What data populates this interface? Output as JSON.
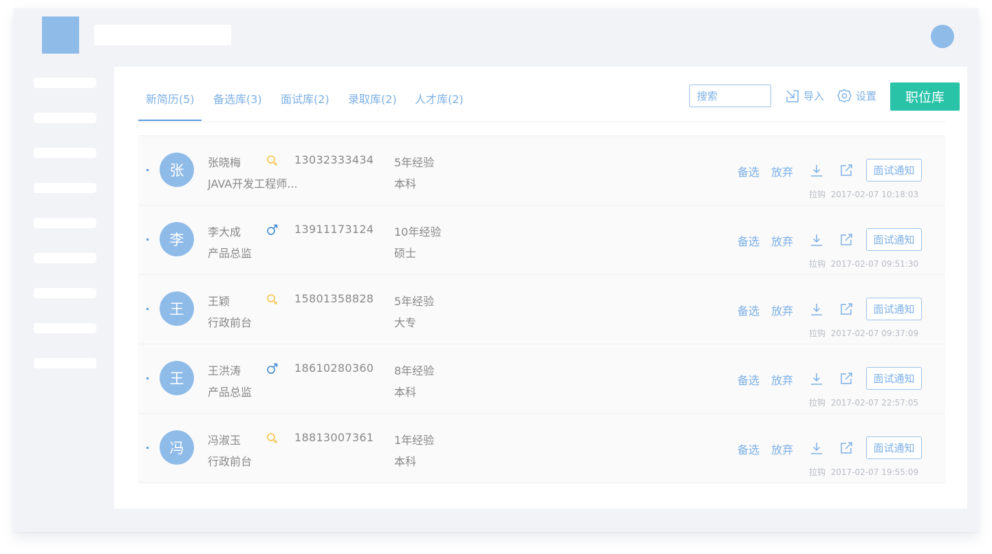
{
  "tabs": [
    {
      "label": "新简历(5)"
    },
    {
      "label": "备选库(3)"
    },
    {
      "label": "面试库(2)"
    },
    {
      "label": "录取库(2)"
    },
    {
      "label": "人才库(2)"
    }
  ],
  "toolbar": {
    "search_placeholder": "搜索",
    "import_label": "导入",
    "settings_label": "设置",
    "primary_label": "职位库"
  },
  "actions": {
    "shortlist": "备选",
    "discard": "放弃",
    "notify": "面试通知"
  },
  "colors": {
    "accent": "#7db0e6",
    "primary": "#29c3a8",
    "female": "#f5c242",
    "male": "#3a86d1"
  },
  "candidates": [
    {
      "avatar": "张",
      "name": "张晓梅",
      "gender": "female",
      "phone": "13032333434",
      "experience": "5年经验",
      "position": "JAVA开发工程师...",
      "education": "本科",
      "source": "拉钩",
      "time": "2017-02-07 10:18:03"
    },
    {
      "avatar": "李",
      "name": "李大成",
      "gender": "male",
      "phone": "13911173124",
      "experience": "10年经验",
      "position": "产品总监",
      "education": "硕士",
      "source": "拉钩",
      "time": "2017-02-07 09:51:30"
    },
    {
      "avatar": "王",
      "name": "王颖",
      "gender": "female",
      "phone": "15801358828",
      "experience": "5年经验",
      "position": "行政前台",
      "education": "大专",
      "source": "拉钩",
      "time": "2017-02-07 09:37:09"
    },
    {
      "avatar": "王",
      "name": "王洪涛",
      "gender": "male",
      "phone": "18610280360",
      "experience": "8年经验",
      "position": "产品总监",
      "education": "本科",
      "source": "拉钩",
      "time": "2017-02-07 22:57:05"
    },
    {
      "avatar": "冯",
      "name": "冯淑玉",
      "gender": "female",
      "phone": "18813007361",
      "experience": "1年经验",
      "position": "行政前台",
      "education": "本科",
      "source": "拉钩",
      "time": "2017-02-07 19:55:09"
    }
  ]
}
